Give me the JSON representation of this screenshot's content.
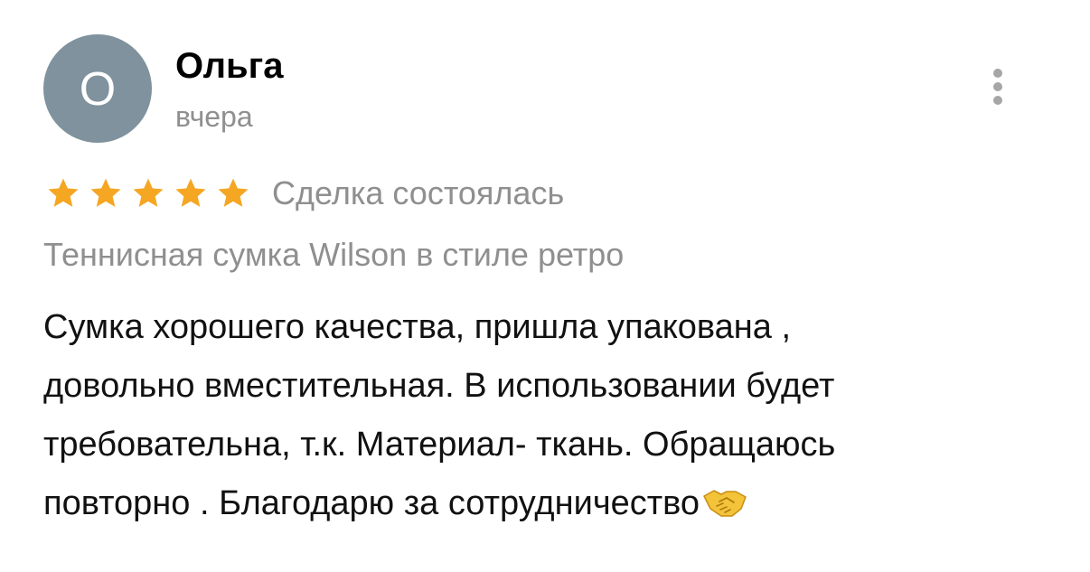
{
  "review": {
    "author": {
      "initial": "О",
      "name": "Ольга",
      "date": "вчера",
      "avatar_color": "#7f929d"
    },
    "menu_icon": "more-vertical-icon",
    "rating": {
      "value": 5,
      "max": 5,
      "star_color": "#f5a623"
    },
    "deal_status": "Сделка состоялась",
    "product_title": "Теннисная сумка Wilson в стиле ретро",
    "text_lines": [
      "Сумка хорошего качества, пришла упакована ,",
      "довольно вместительная. В использовании будет",
      "требовательна, т.к. Материал- ткань. Обращаюсь",
      "повторно . Благодарю за сотрудничество"
    ],
    "trailing_emoji": "handshake-icon"
  }
}
